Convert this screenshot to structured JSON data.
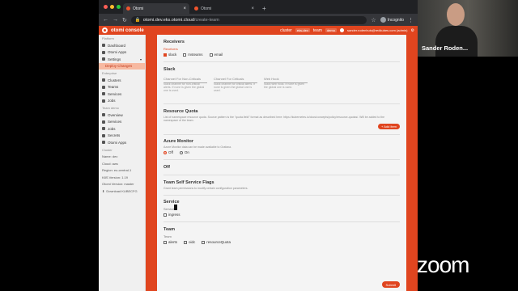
{
  "browser": {
    "tabs": [
      {
        "label": "Otomi"
      },
      {
        "label": "Otomi"
      }
    ],
    "url": "otomi.dev.eks.otomi.cloud",
    "url_path": "/create-team",
    "incognito_label": "Incognito"
  },
  "app": {
    "brand": "otomi console",
    "cluster_label": "cluster",
    "cluster_value": "eks-dev",
    "team_label": "team",
    "team_value": "demo",
    "user": "sander.rodenhuis@redkubes.com (admin)"
  },
  "sidebar": {
    "platform_head": "Platform",
    "platform_items": [
      {
        "label": "Dashboard"
      },
      {
        "label": "Otomi Apps"
      },
      {
        "label": "Settings"
      }
    ],
    "settings_sub": "Deploy Changes",
    "enterprise_head": "Enterprise",
    "enterprise_items": [
      {
        "label": "Clusters"
      },
      {
        "label": "Teams"
      },
      {
        "label": "Services"
      },
      {
        "label": "Jobs"
      }
    ],
    "team_head": "Team demo",
    "team_items": [
      {
        "label": "Overview"
      },
      {
        "label": "Services"
      },
      {
        "label": "Jobs"
      },
      {
        "label": "Secrets"
      },
      {
        "label": "Otomi Apps"
      }
    ],
    "cluster_head": "Cluster",
    "meta": [
      {
        "label": "Name: dev"
      },
      {
        "label": "Cloud: aws"
      },
      {
        "label": "Region: eu-central-1"
      },
      {
        "label": "K8S Version: 1.19"
      },
      {
        "label": "Otomi Version: master"
      },
      {
        "label": "Download KUBECFG"
      }
    ]
  },
  "form": {
    "receivers": {
      "title": "Receivers",
      "sub_label": "Receivers",
      "options": [
        {
          "label": "slack"
        },
        {
          "label": "msteams"
        },
        {
          "label": "email"
        }
      ]
    },
    "slack": {
      "title": "Slack",
      "fields": [
        {
          "label": "Channel For Non-Criticals",
          "desc": "Slack channel for non-critical alerts. If none is given the global one is used."
        },
        {
          "label": "Channel For Criticals",
          "desc": "Slack channel for critical alerts. If none is given the global one is used."
        },
        {
          "label": "Web Hook",
          "desc": "Slack web hook. If none is given the global one is used."
        }
      ]
    },
    "quota": {
      "title": "Resource Quota",
      "desc": "List of namespace resource quota. Source pattern is the \"quota.field\" format as described here: https://kubernetes.io/docs/concepts/policy/resource-quotas/. Will be added to the namespace of the team.",
      "add_label": "+ Add item"
    },
    "azure": {
      "title": "Azure Monitor",
      "desc": "Azure Monitor data can be made available to Grafana.",
      "off_label": "Off",
      "on_label": "On"
    },
    "off_title": "Off",
    "flags": {
      "title": "Team Self Service Flags",
      "desc": "Grant team permissions to modify certain configuration parameters."
    },
    "service": {
      "title": "Service",
      "sub_label": "Service",
      "options": [
        {
          "label": "ingress"
        }
      ]
    },
    "team": {
      "title": "Team",
      "sub_label": "Team",
      "options": [
        {
          "label": "alerts"
        },
        {
          "label": "oidc"
        },
        {
          "label": "resourceQuota"
        }
      ]
    },
    "submit_label": "Submit"
  },
  "video": {
    "participant_name": "Sander Roden..."
  },
  "zoom": {
    "logo_text": "zoom"
  },
  "colors": {
    "accent": "#e0451f",
    "browser_bg": "#202124"
  }
}
